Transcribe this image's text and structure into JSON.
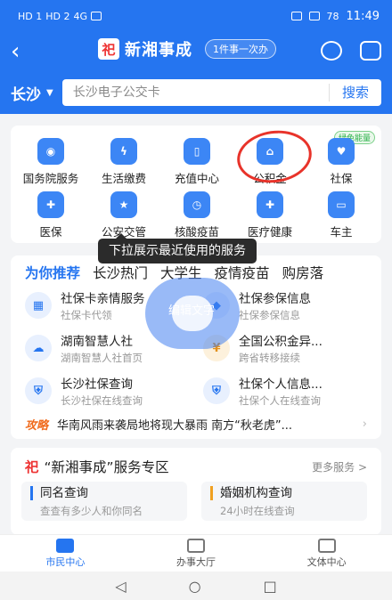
{
  "status": {
    "sim1": "HD 1",
    "sim2": "HD 2",
    "signal": "4G",
    "battery": "78",
    "time": "11:49"
  },
  "header": {
    "brand_logo": "祀",
    "brand": "新湘事成",
    "badge": "1件事一次办"
  },
  "search": {
    "city": "长沙",
    "placeholder": "长沙电子公交卡",
    "button": "搜索"
  },
  "services": [
    {
      "label": "国务院服务",
      "icon": "state-council-icon"
    },
    {
      "label": "生活缴费",
      "icon": "utility-payment-icon"
    },
    {
      "label": "充值中心",
      "icon": "tablet-topup-icon"
    },
    {
      "label": "公积金",
      "icon": "housing-fund-icon"
    },
    {
      "label": "社保",
      "icon": "social-security-icon"
    },
    {
      "label": "医保",
      "icon": "medical-insurance-icon"
    },
    {
      "label": "公安交管",
      "icon": "police-cap-icon"
    },
    {
      "label": "核酸疫苗",
      "icon": "clock-test-icon"
    },
    {
      "label": "医疗健康",
      "icon": "health-icon"
    },
    {
      "label": "车主",
      "icon": "car-icon"
    }
  ],
  "green_tag": "绿色能量",
  "tooltip": "下拉展示最近使用的服务",
  "rec_tabs": [
    "为你推荐",
    "长沙热门",
    "大学生",
    "疫情疫苗",
    "购房落"
  ],
  "rec_items": [
    {
      "title": "社保卡亲情服务",
      "sub": "社保卡代领"
    },
    {
      "title": "社保参保信息",
      "sub": "社保参保信息"
    },
    {
      "title": "湖南智慧人社",
      "sub": "湖南智慧人社首页"
    },
    {
      "title": "全国公积金异...",
      "sub": "跨省转移接续"
    },
    {
      "title": "长沙社保查询",
      "sub": "长沙社保在线查询"
    },
    {
      "title": "社保个人信息...",
      "sub": "社保个人在线查询"
    }
  ],
  "float_text": "编辑文字",
  "news": {
    "tag": "攻略",
    "text": "华南风雨来袭局地将现大暴雨 南方“秋老虎”..."
  },
  "zone": {
    "logo": "祀",
    "title": "“新湘事成”服务专区",
    "more": "更多服务 >",
    "boxes": [
      {
        "title": "同名查询",
        "sub": "查查有多少人和你同名"
      },
      {
        "title": "婚姻机构查询",
        "sub": "24小时在线查询"
      }
    ]
  },
  "bottom_nav": [
    "市民中心",
    "办事大厅",
    "文体中心"
  ],
  "sys_nav": [
    "◁",
    "○",
    "□"
  ],
  "colors": {
    "primary": "#2575f0",
    "annotation": "#e8332a",
    "accent_orange": "#f06a1b"
  }
}
